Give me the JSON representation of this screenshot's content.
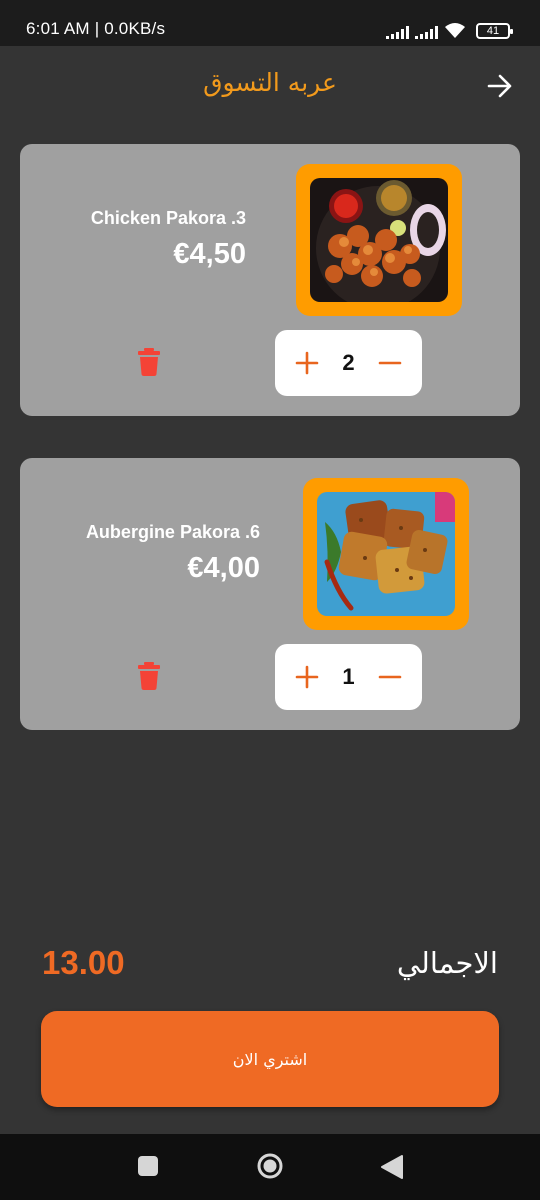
{
  "status_bar": {
    "time": "6:01 AM | 0.0KB/s",
    "battery": "41",
    "icons": [
      "signal-icon",
      "signal-icon",
      "wifi-icon",
      "battery-icon"
    ]
  },
  "header": {
    "title": "عربه التسوق",
    "back_icon": "arrow-right-icon"
  },
  "cart": {
    "items": [
      {
        "name": "Chicken Pakora .3",
        "price": "€4,50",
        "quantity": "2",
        "image": "chicken-pakora-photo"
      },
      {
        "name": "Aubergine Pakora .6",
        "price": "€4,00",
        "quantity": "1",
        "image": "aubergine-pakora-photo"
      }
    ]
  },
  "summary": {
    "total_label": "الاجمالي",
    "total_value": "13.00"
  },
  "buy_button": {
    "label": "اشتري الان"
  },
  "colors": {
    "background": "#343434",
    "card": "#a0a0a0",
    "accent_orange": "#ef6a24",
    "title_orange": "#f29a1c",
    "image_frame": "#ff9c00",
    "trash_red": "#f44336"
  }
}
